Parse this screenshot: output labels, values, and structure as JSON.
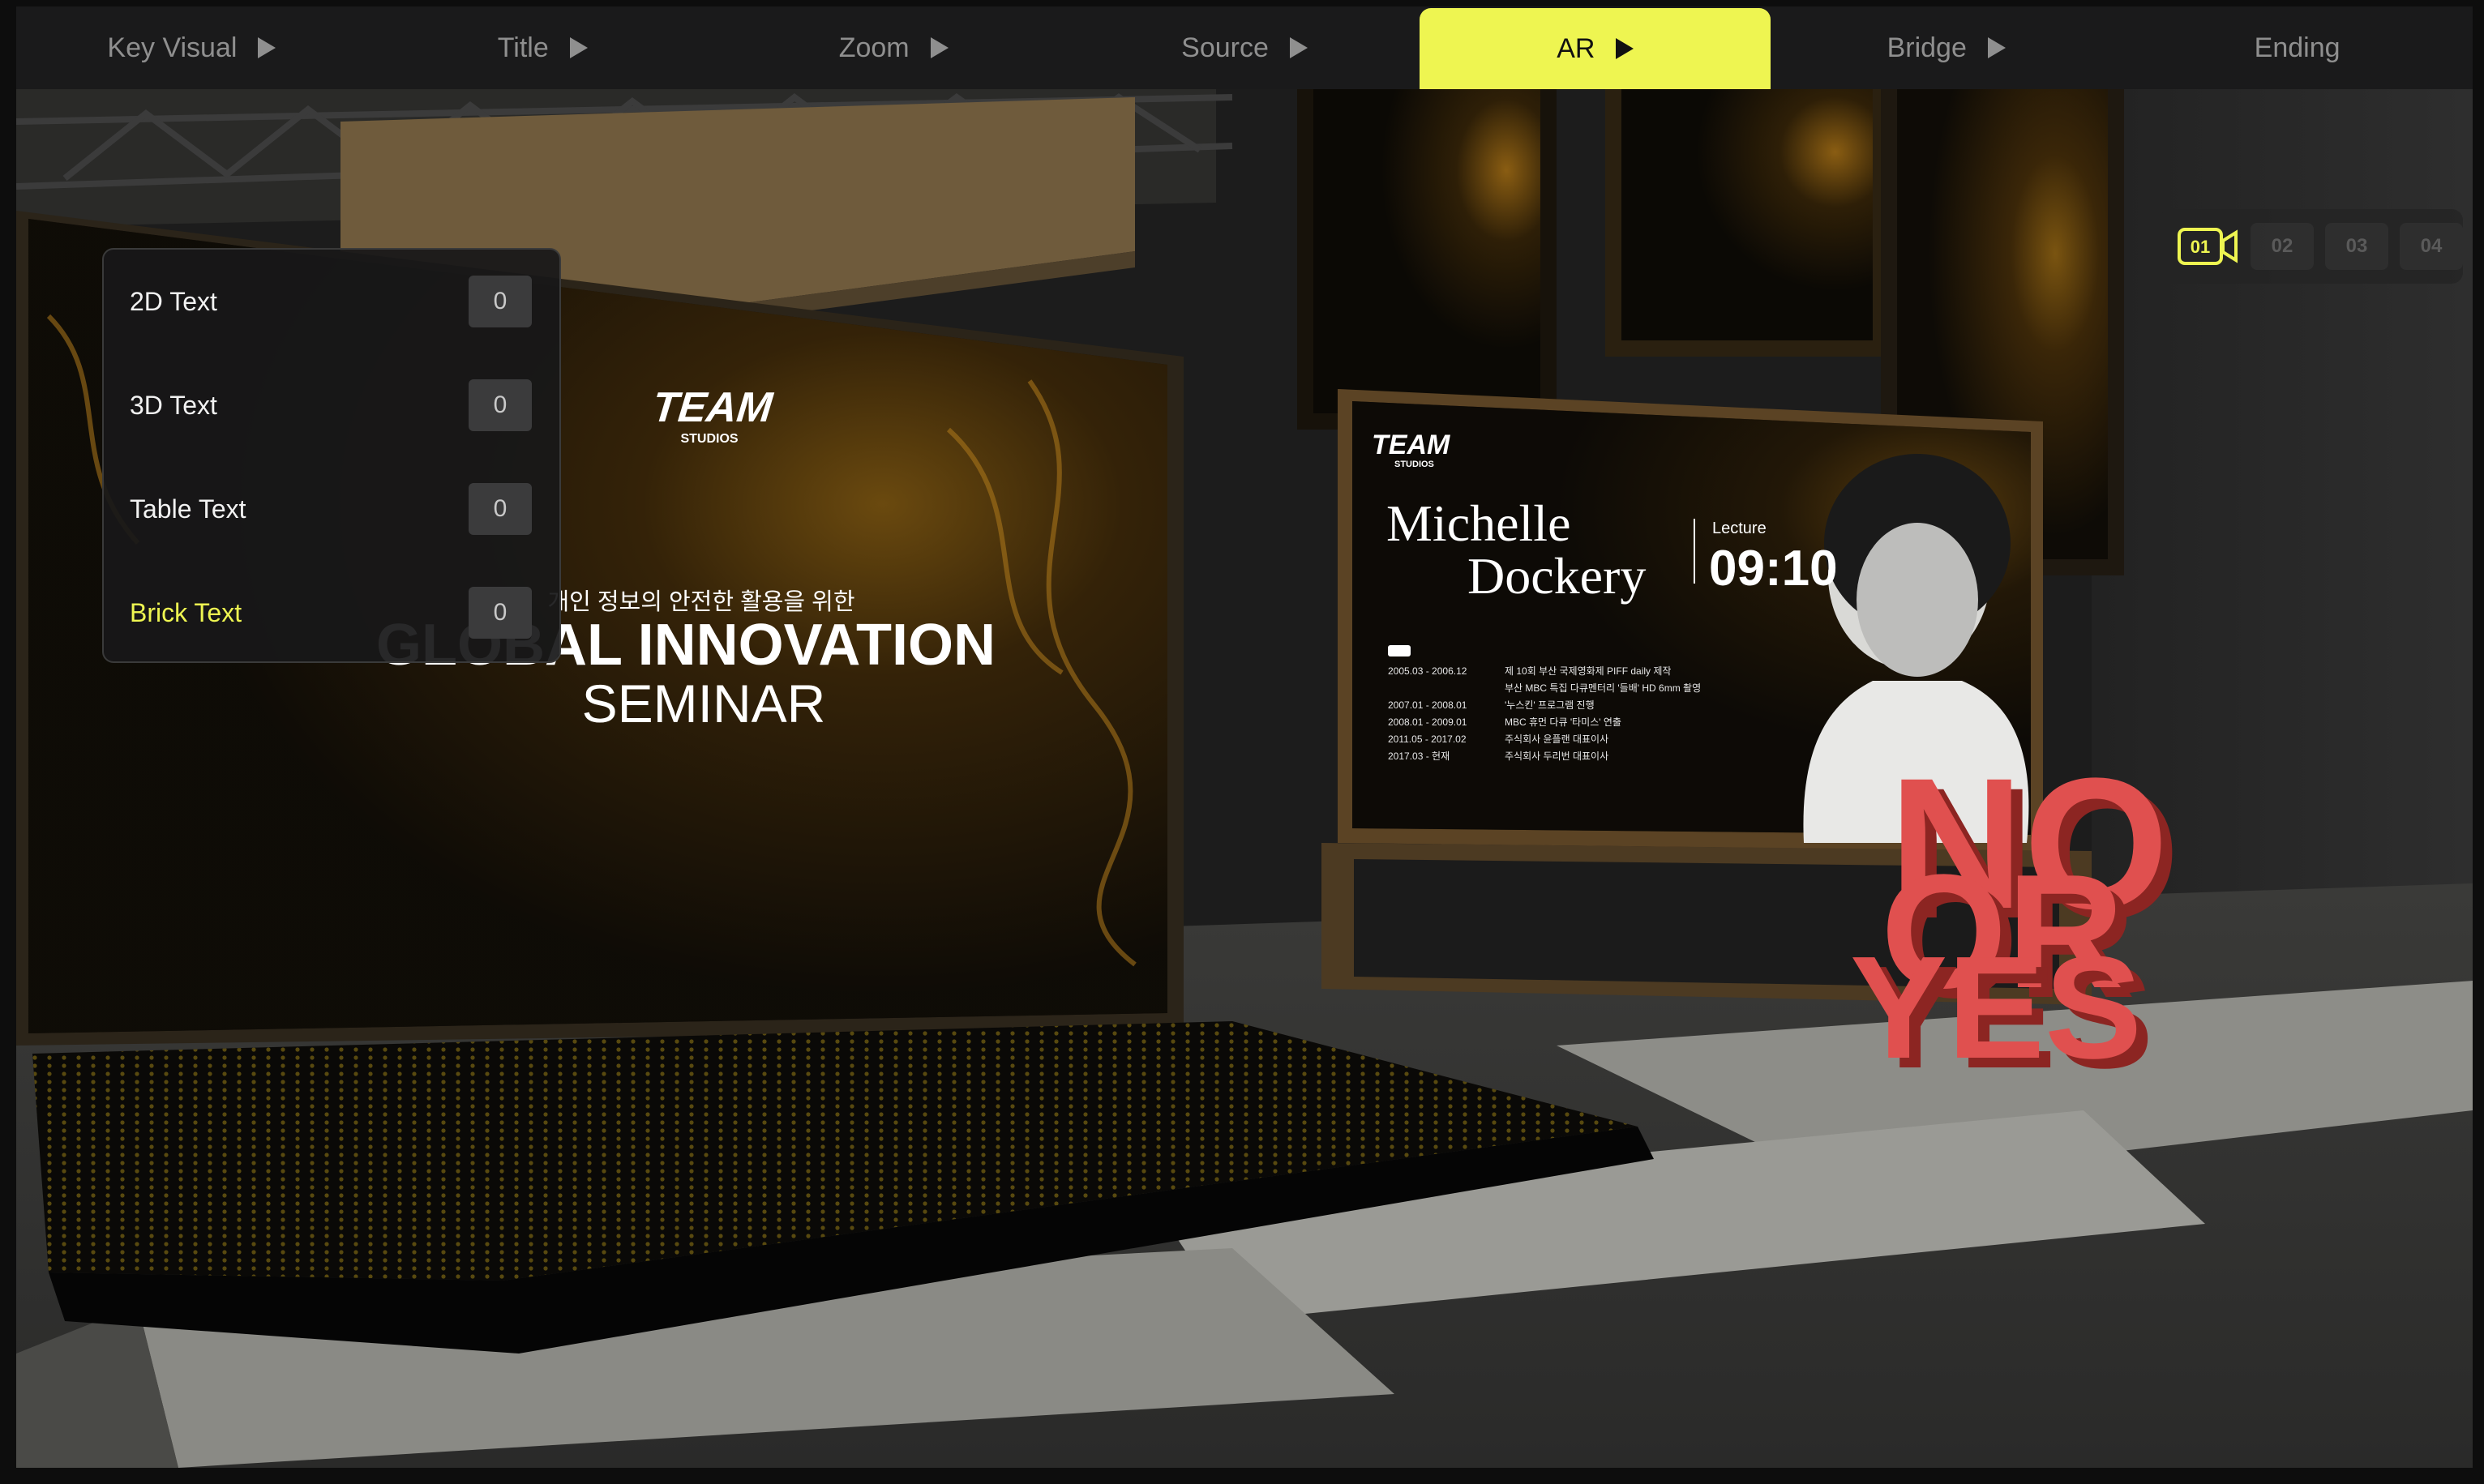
{
  "nav": {
    "tabs": [
      {
        "label": "Key Visual",
        "play": true
      },
      {
        "label": "Title",
        "play": true
      },
      {
        "label": "Zoom",
        "play": true
      },
      {
        "label": "Source",
        "play": true
      },
      {
        "label": "AR",
        "play": true,
        "active": true
      },
      {
        "label": "Bridge",
        "play": true
      },
      {
        "label": "Ending",
        "play": false
      }
    ],
    "accent": "#eef551"
  },
  "text_panel": {
    "rows": [
      {
        "label": "2D Text",
        "value": "0"
      },
      {
        "label": "3D Text",
        "value": "0"
      },
      {
        "label": "Table Text",
        "value": "0"
      },
      {
        "label": "Brick Text",
        "value": "0",
        "highlight": true
      }
    ]
  },
  "cameras": {
    "icon": "video-camera-icon",
    "items": [
      "01",
      "02",
      "03",
      "04"
    ],
    "active": "01"
  },
  "scene": {
    "left_screen": {
      "logo": "TEAM",
      "logo_sub": "STUDIOS",
      "korean_line": "개인 정보의 안전한 활용을 위한",
      "title": "GLOBAL INNOVATION",
      "subtitle": "SEMINAR"
    },
    "right_screen": {
      "logo": "TEAM",
      "logo_sub": "STUDIOS",
      "first_name": "Michelle",
      "last_name": "Dockery",
      "lecture_label": "Lecture",
      "time": "09:10",
      "career": [
        {
          "date": "2005.03 - 2006.12",
          "text": "제 10회 부산 국제영화제 PIFF daily 제작"
        },
        {
          "date": "",
          "text": "부산 MBC 특집 다큐멘터리 '들배' HD 6mm 촬영"
        },
        {
          "date": "2007.01 - 2008.01",
          "text": "'누스킨' 프로그램 진행"
        },
        {
          "date": "2008.01 - 2009.01",
          "text": "MBC 휴먼 다큐 '타미스' 연출"
        },
        {
          "date": "2011.05 - 2017.02",
          "text": "주식회사 윤플랜 대표이사"
        },
        {
          "date": "2017.03 - 현재",
          "text": "주식회사 두리번 대표이사"
        }
      ]
    },
    "ar_text": {
      "line1": "NO",
      "line2": "OR",
      "line3": "YES",
      "color": "#e0504f"
    }
  }
}
